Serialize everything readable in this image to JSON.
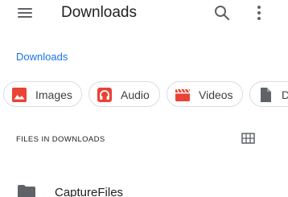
{
  "appbar": {
    "title": "Downloads",
    "menu_icon": "hamburger-menu-icon",
    "search_icon": "search-icon",
    "more_icon": "more-vert-icon"
  },
  "breadcrumb": {
    "label": "Downloads"
  },
  "filters": [
    {
      "label": "Images",
      "icon": "image-icon",
      "color": "#ea4335"
    },
    {
      "label": "Audio",
      "icon": "headphones-icon",
      "color": "#ea4335"
    },
    {
      "label": "Videos",
      "icon": "movie-icon",
      "color": "#ea4335"
    },
    {
      "label": "Documents",
      "icon": "document-icon",
      "color": "#5f6368"
    }
  ],
  "section": {
    "title": "FILES IN DOWNLOADS",
    "view_toggle_icon": "grid-view-icon"
  },
  "files": [
    {
      "name": "CaptureFiles",
      "icon": "folder-icon"
    }
  ],
  "colors": {
    "accent": "#1a73e8",
    "filter_icon": "#ea4335",
    "icon_gray": "#5f6368"
  }
}
